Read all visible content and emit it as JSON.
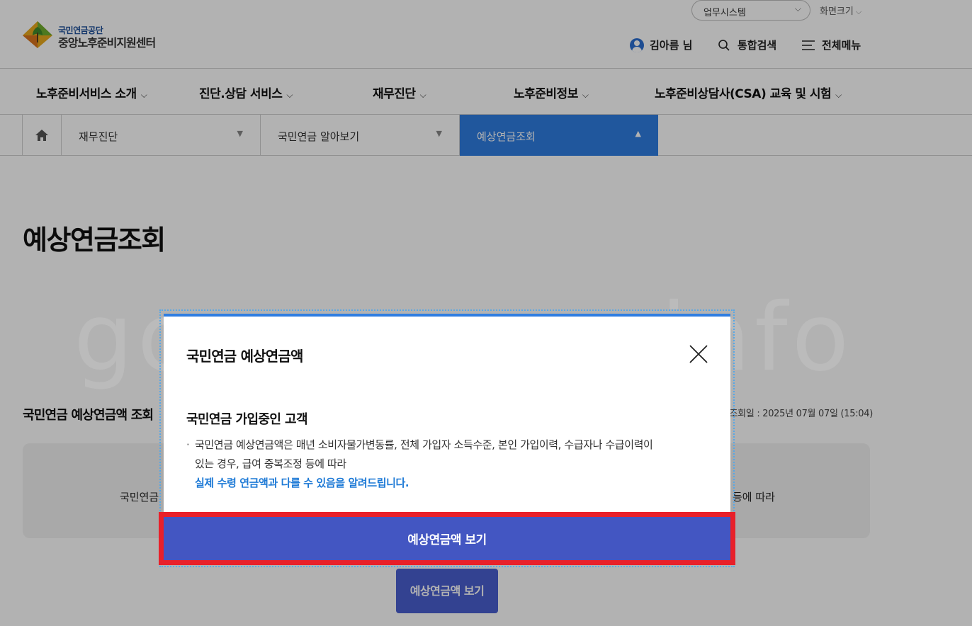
{
  "header": {
    "logo": {
      "top": "국민연금공단",
      "main": "중앙노후준비지원센터"
    },
    "system_select": "업무시스템",
    "font_size_label": "화면크기",
    "user_name": "김아름 님",
    "search_label": "통합검색",
    "menu_label": "전체메뉴"
  },
  "gnb": {
    "items": [
      {
        "label": "노후준비서비스 소개"
      },
      {
        "label": "진단.상담 서비스"
      },
      {
        "label": "재무진단"
      },
      {
        "label": "노후준비정보"
      },
      {
        "label": "노후준비상담사(CSA) 교육 및 시험"
      }
    ]
  },
  "location": {
    "segments": [
      {
        "label": "재무진단"
      },
      {
        "label": "국민연금 알아보기"
      },
      {
        "label": "예상연금조회"
      }
    ]
  },
  "page": {
    "title": "예상연금조회",
    "section_title": "국민연금 예상연금액 조회",
    "query_date": "조회일 : 2025년 07월 07일 (15:04)",
    "info_left": "국민연금",
    "info_right": "등에 따라",
    "button_label": "예상연금액 보기"
  },
  "watermark": "gomawoon-info",
  "modal": {
    "title": "국민연금 예상연금액",
    "subtitle": "국민연금 가입중인 고객",
    "bullet": "·",
    "body_line1": "국민연금 예상연금액은 매년 소비자물가변동률, 전체 가입자 소득수준, 본인 가입이력, 수급자나 수급이력이",
    "body_line2": "있는 경우, 급여 중복조정 등에 따라",
    "body_highlight": "실제 수령 연금액과 다를 수 있음을 알려드립니다.",
    "button_label": "예상연금액 보기"
  },
  "colors": {
    "accent_blue": "#2f7de1",
    "modal_button": "#4356c2",
    "highlight_red": "#e8202a",
    "highlight_text": "#1e7ad6"
  }
}
